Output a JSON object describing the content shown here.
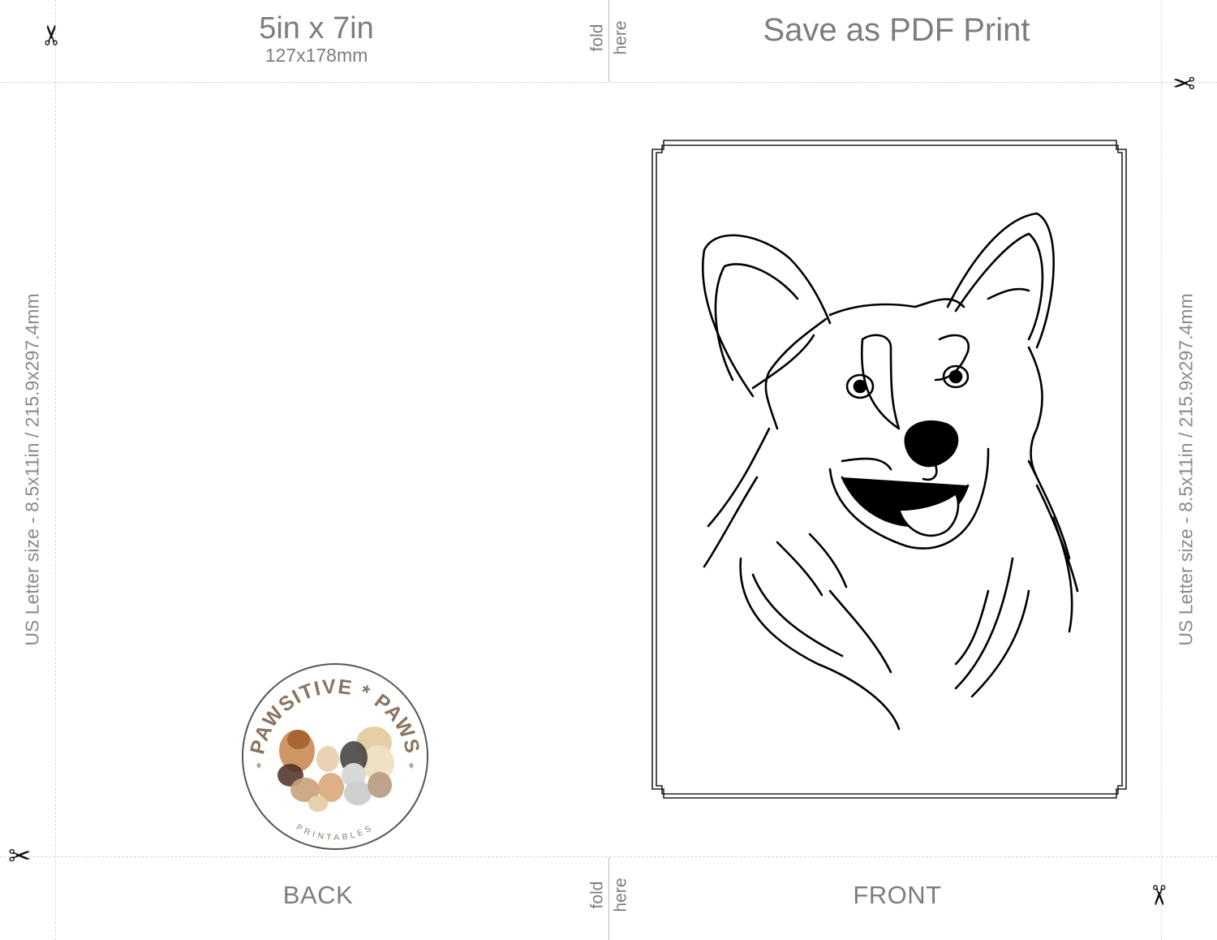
{
  "header": {
    "card_size": "5in x 7in",
    "card_size_mm": "127x178mm",
    "save_instruction": "Save as PDF Print"
  },
  "fold": {
    "word1": "fold",
    "word2": "here"
  },
  "side_label": "US Letter size - 8.5x11in / 215.9x297.4mm",
  "footer": {
    "back_label": "BACK",
    "front_label": "FRONT"
  },
  "logo": {
    "top_text": "PAWSITIVE * PAWS",
    "bottom_text": "PRINTABLES"
  },
  "icons": {
    "scissors": "✂"
  },
  "colors": {
    "guide": "#d6d6d6",
    "text": "#7d7d7d",
    "logo_brown": "#8a7462"
  }
}
